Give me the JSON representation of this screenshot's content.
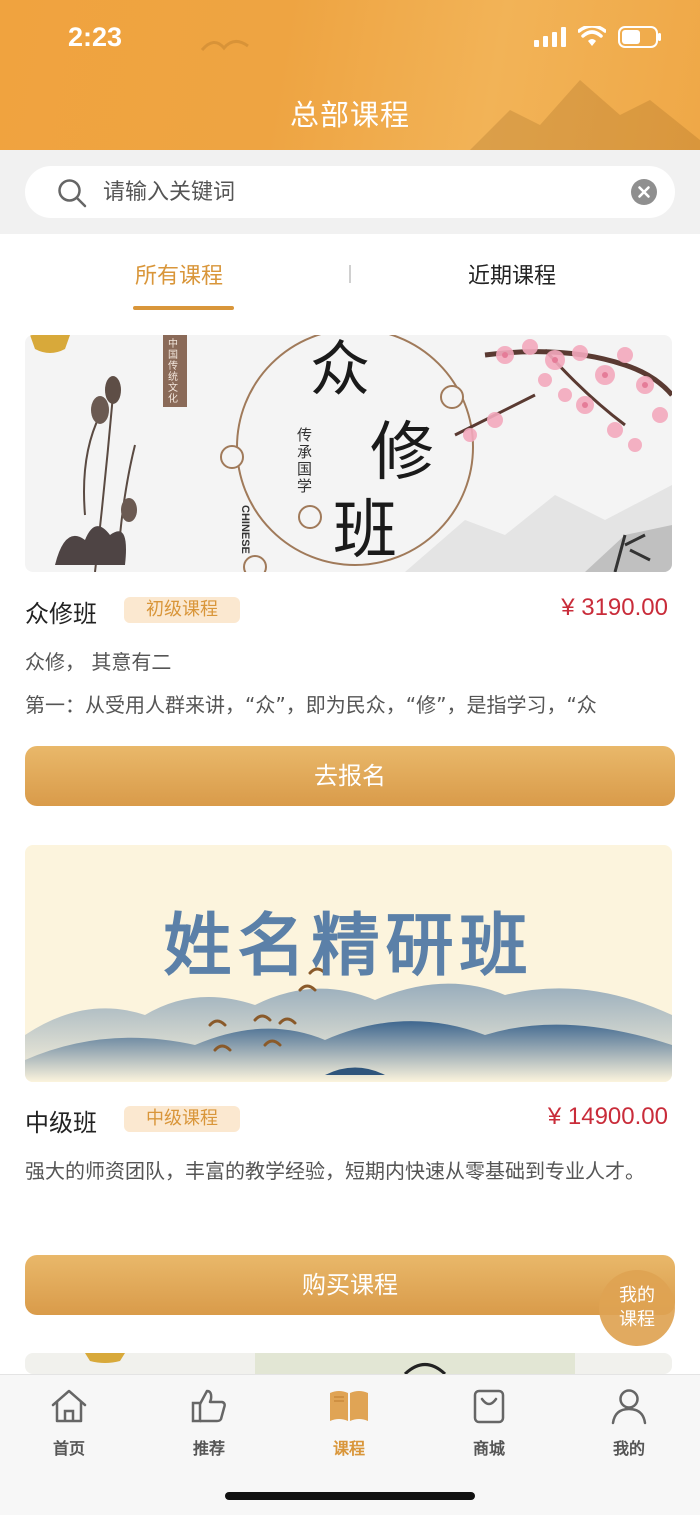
{
  "status_bar": {
    "time": "2:23"
  },
  "header": {
    "title": "总部课程"
  },
  "search": {
    "placeholder": "请输入关键词",
    "value": ""
  },
  "tabs": [
    {
      "label": "所有课程",
      "active": true
    },
    {
      "label": "近期课程",
      "active": false
    }
  ],
  "courses": [
    {
      "name": "众修班",
      "level": "初级课程",
      "price": "¥ 3190.00",
      "desc_lines": [
        "众修， 其意有二",
        "第一：从受用人群来讲，“众”，即为民众，“修”，是指学习，“众"
      ],
      "cta": "去报名",
      "banner": {
        "big_chars": [
          "众",
          "修",
          "班"
        ],
        "sub": "传承国学",
        "en": "CHINESE",
        "seal": "中国传统文化"
      }
    },
    {
      "name": "中级班",
      "level": "中级课程",
      "price": "¥ 14900.00",
      "desc_lines": [
        "强大的师资团队，丰富的教学经验，短期内快速从零基础到专业人才。"
      ],
      "cta": "购买课程",
      "banner": {
        "title": "姓名精研班"
      }
    }
  ],
  "fab": {
    "line1": "我的",
    "line2": "课程"
  },
  "bottom_nav": [
    {
      "label": "首页",
      "icon": "home-icon",
      "active": false
    },
    {
      "label": "推荐",
      "icon": "thumbs-up-icon",
      "active": false
    },
    {
      "label": "课程",
      "icon": "book-icon",
      "active": true
    },
    {
      "label": "商城",
      "icon": "shopping-bag-icon",
      "active": false
    },
    {
      "label": "我的",
      "icon": "user-icon",
      "active": false
    }
  ],
  "colors": {
    "accent": "#d9963a",
    "price": "#c92c3a",
    "header": "#f0a33f"
  }
}
